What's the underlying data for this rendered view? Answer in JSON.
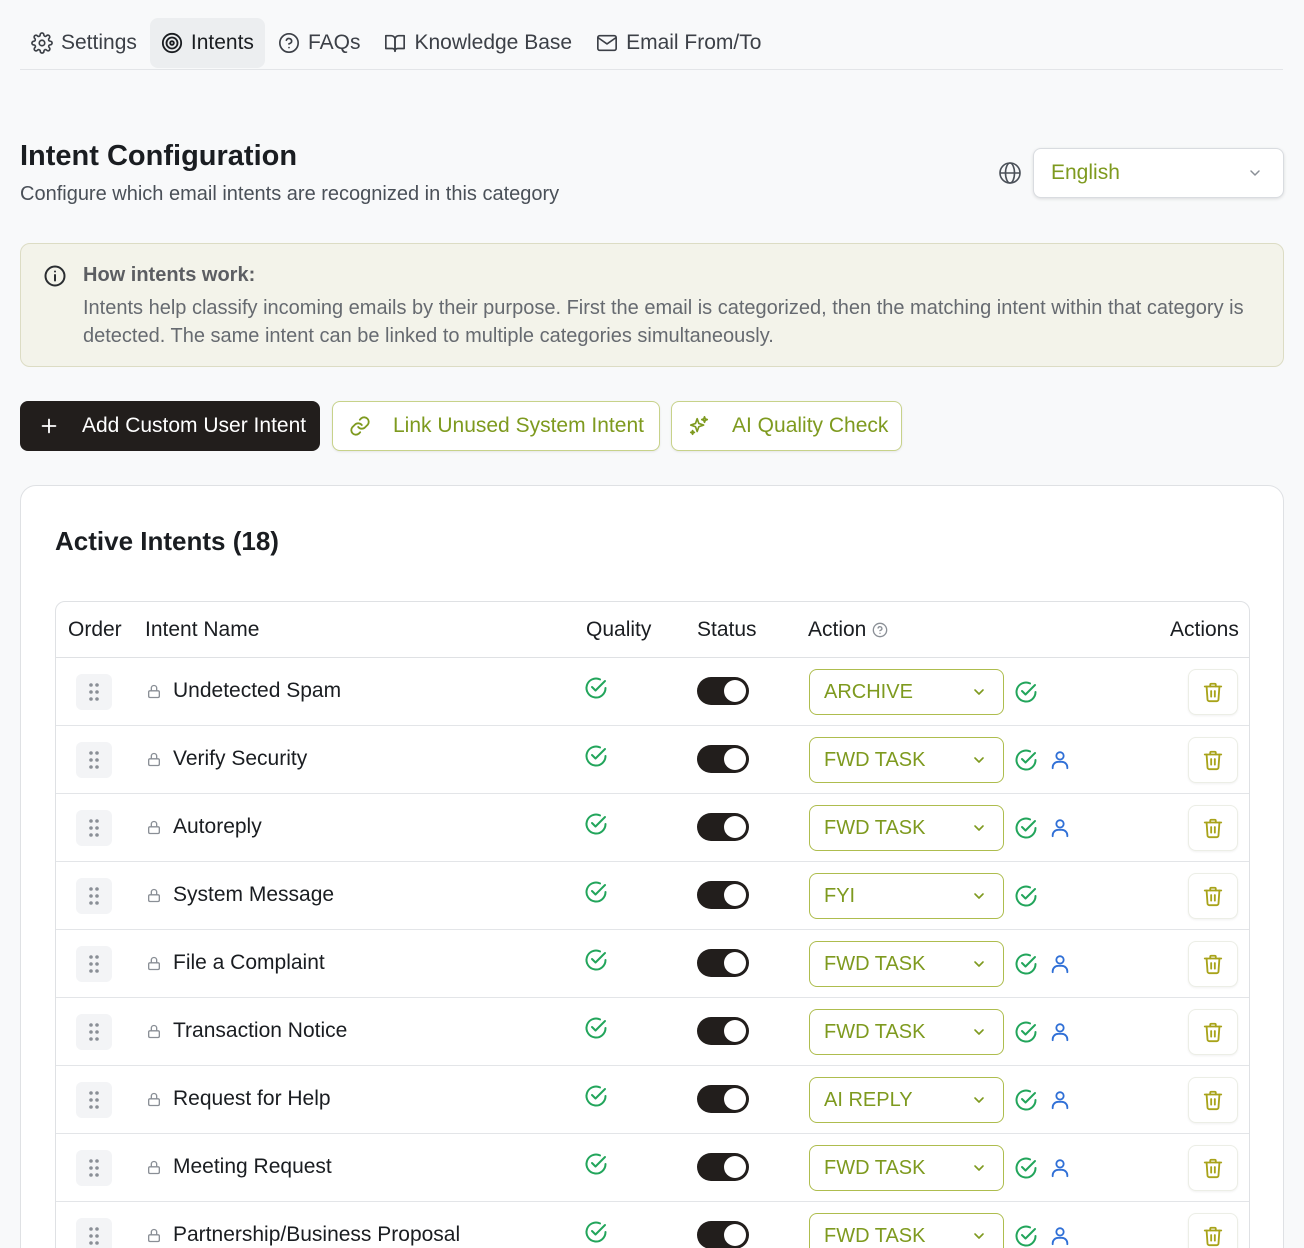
{
  "tabs": [
    {
      "label": "Settings",
      "icon": "gear-icon"
    },
    {
      "label": "Intents",
      "icon": "target-icon",
      "active": true
    },
    {
      "label": "FAQs",
      "icon": "help-circle-icon"
    },
    {
      "label": "Knowledge Base",
      "icon": "book-icon"
    },
    {
      "label": "Email From/To",
      "icon": "mail-icon"
    }
  ],
  "header": {
    "title": "Intent Configuration",
    "subtitle": "Configure which email intents are recognized in this category",
    "language": "English"
  },
  "info": {
    "title": "How intents work:",
    "text": "Intents help classify incoming emails by their purpose. First the email is categorized, then the matching intent within that category is detected. The same intent can be linked to multiple categories simultaneously."
  },
  "buttons": {
    "add": "Add Custom User Intent",
    "link": "Link Unused System Intent",
    "ai": "AI Quality Check"
  },
  "card": {
    "title": "Active Intents (18)"
  },
  "table": {
    "headers": {
      "order": "Order",
      "name": "Intent Name",
      "quality": "Quality",
      "status": "Status",
      "action": "Action",
      "actions": "Actions"
    },
    "rows": [
      {
        "name": "Undetected Spam",
        "action": "ARCHIVE",
        "enabled": true,
        "user_icon": false
      },
      {
        "name": "Verify Security",
        "action": "FWD TASK",
        "enabled": true,
        "user_icon": true
      },
      {
        "name": "Autoreply",
        "action": "FWD TASK",
        "enabled": true,
        "user_icon": true
      },
      {
        "name": "System Message",
        "action": "FYI",
        "enabled": true,
        "user_icon": false
      },
      {
        "name": "File a Complaint",
        "action": "FWD TASK",
        "enabled": true,
        "user_icon": true
      },
      {
        "name": "Transaction Notice",
        "action": "FWD TASK",
        "enabled": true,
        "user_icon": true
      },
      {
        "name": "Request for Help",
        "action": "AI REPLY",
        "enabled": true,
        "user_icon": true
      },
      {
        "name": "Meeting Request",
        "action": "FWD TASK",
        "enabled": true,
        "user_icon": true
      },
      {
        "name": "Partnership/Business Proposal",
        "action": "FWD TASK",
        "enabled": true,
        "user_icon": true
      }
    ]
  },
  "colors": {
    "accent": "#7e9a1f",
    "success": "#22a55b",
    "user": "#2f6fd6",
    "dark": "#221e1c"
  }
}
